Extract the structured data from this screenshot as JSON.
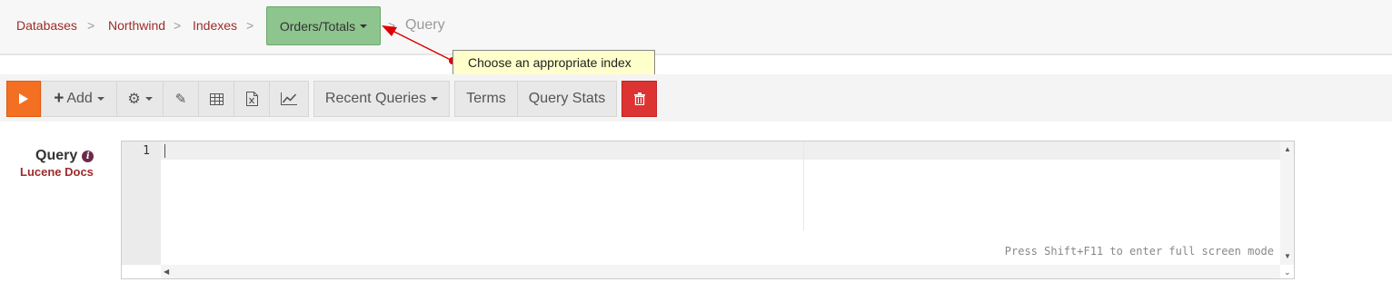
{
  "breadcrumb": {
    "items": [
      "Databases",
      "Northwind",
      "Indexes"
    ],
    "separator": ">",
    "index_selector": "Orders/Totals",
    "current": "Query"
  },
  "tooltip": {
    "text": "Choose an appropriate index"
  },
  "toolbar": {
    "add_label": "Add",
    "recent_label": "Recent Queries",
    "terms_label": "Terms",
    "stats_label": "Query Stats"
  },
  "query": {
    "label": "Query",
    "docs_link": "Lucene Docs",
    "line_number": "1",
    "value": "",
    "hint": "Press Shift+F11 to enter full screen mode"
  },
  "colors": {
    "run_button": "#f36f21",
    "index_button": "#8ec48e",
    "delete_button": "#dd3333",
    "link": "#9e2b2b",
    "tooltip_bg": "#ffffcc",
    "arrow": "#dd0000"
  }
}
